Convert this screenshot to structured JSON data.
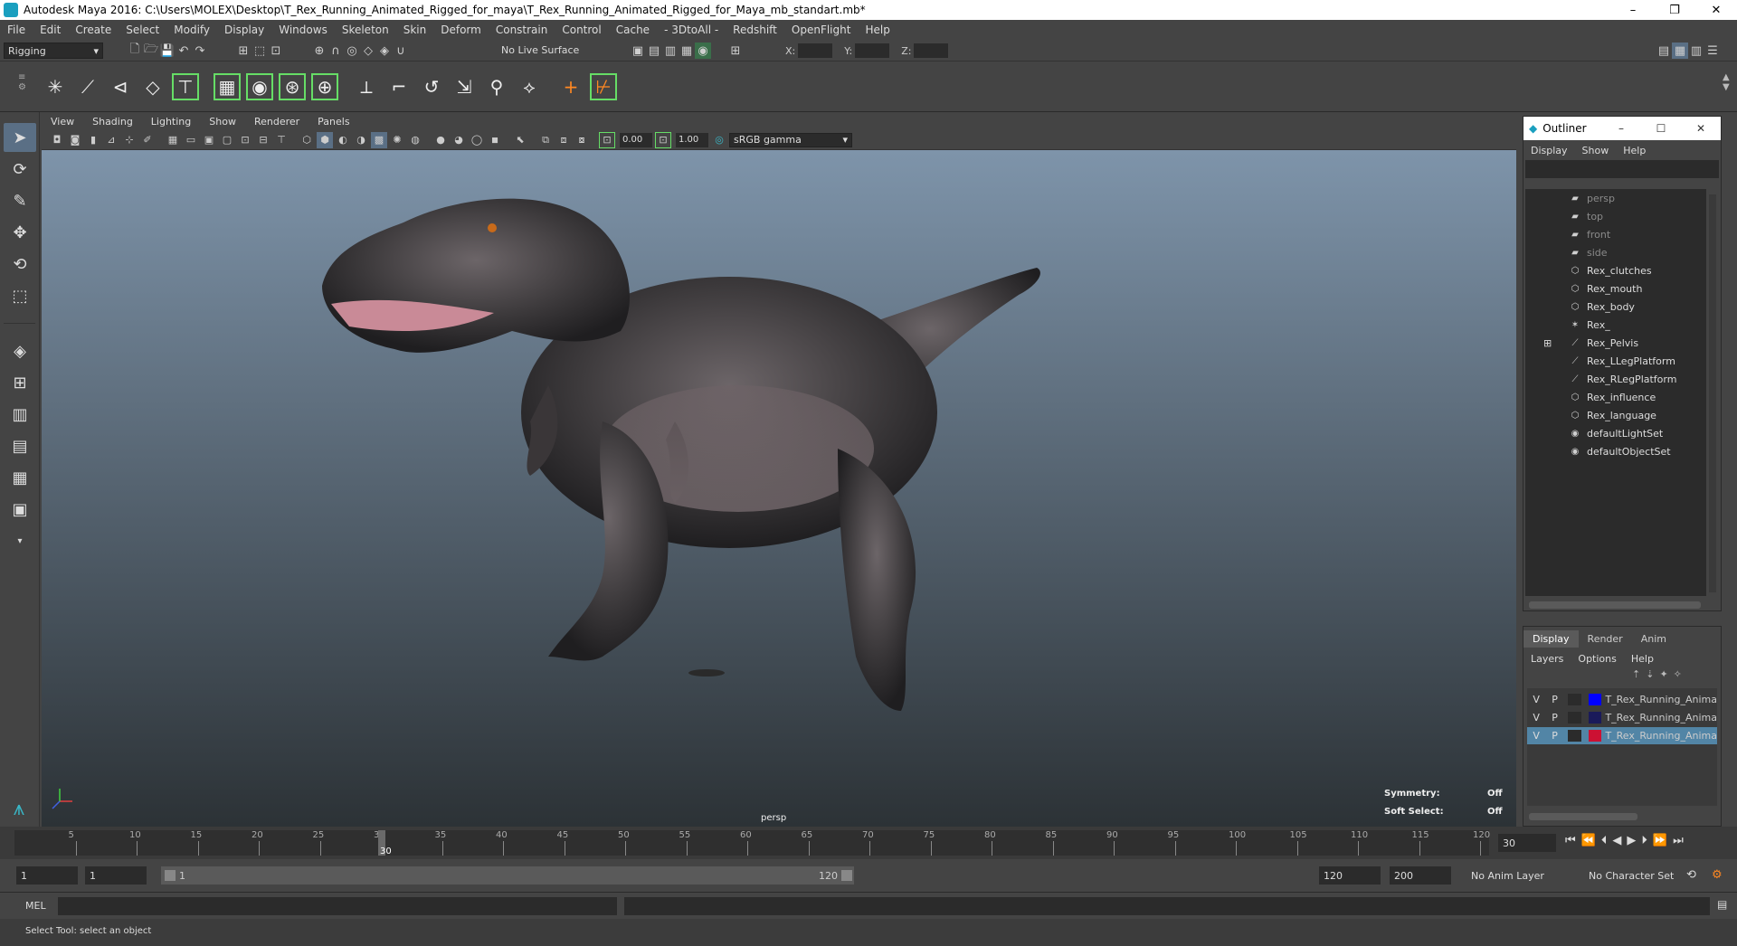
{
  "titlebar": {
    "title": "Autodesk Maya 2016: C:\\Users\\MOLEX\\Desktop\\T_Rex_Running_Animated_Rigged_for_maya\\T_Rex_Running_Animated_Rigged_for_Maya_mb_standart.mb*",
    "minimize": "–",
    "restore": "❐",
    "close": "✕"
  },
  "menubar": [
    "File",
    "Edit",
    "Create",
    "Select",
    "Modify",
    "Display",
    "Windows",
    "Skeleton",
    "Skin",
    "Deform",
    "Constrain",
    "Control",
    "Cache",
    "- 3DtoAll -",
    "Redshift",
    "OpenFlight",
    "Help"
  ],
  "statusline": {
    "menuset": "Rigging",
    "live_surface": "No Live Surface",
    "x_label": "X:",
    "y_label": "Y:",
    "z_label": "Z:"
  },
  "viewport": {
    "menu": [
      "View",
      "Shading",
      "Lighting",
      "Show",
      "Renderer",
      "Panels"
    ],
    "exposure": "0.00",
    "gamma": "1.00",
    "colorspace": "sRGB gamma",
    "camera_label": "persp",
    "hud": {
      "symmetry_label": "Symmetry:",
      "symmetry_value": "Off",
      "soft_select_label": "Soft Select:",
      "soft_select_value": "Off"
    }
  },
  "outliner": {
    "title": "Outliner",
    "menu": [
      "Display",
      "Show",
      "Help"
    ],
    "items": [
      {
        "label": "persp",
        "icon": "camera-icon",
        "dim": true
      },
      {
        "label": "top",
        "icon": "camera-icon",
        "dim": true
      },
      {
        "label": "front",
        "icon": "camera-icon",
        "dim": true
      },
      {
        "label": "side",
        "icon": "camera-icon",
        "dim": true
      },
      {
        "label": "Rex_clutches",
        "icon": "mesh-icon",
        "dim": false
      },
      {
        "label": "Rex_mouth",
        "icon": "mesh-icon",
        "dim": false
      },
      {
        "label": "Rex_body",
        "icon": "mesh-icon",
        "dim": false
      },
      {
        "label": "Rex_",
        "icon": "locator-icon",
        "dim": false
      },
      {
        "label": "Rex_Pelvis",
        "icon": "joint-icon",
        "dim": false
      },
      {
        "label": "Rex_LLegPlatform",
        "icon": "joint-icon",
        "dim": false
      },
      {
        "label": "Rex_RLegPlatform",
        "icon": "joint-icon",
        "dim": false
      },
      {
        "label": "Rex_influence",
        "icon": "mesh-icon",
        "dim": false
      },
      {
        "label": "Rex_language",
        "icon": "mesh-icon",
        "dim": false
      },
      {
        "label": "defaultLightSet",
        "icon": "set-icon",
        "dim": false
      },
      {
        "label": "defaultObjectSet",
        "icon": "set-icon",
        "dim": false
      }
    ]
  },
  "layers": {
    "tabs": [
      "Display",
      "Render",
      "Anim"
    ],
    "menu": [
      "Layers",
      "Options",
      "Help"
    ],
    "rows": [
      {
        "v": "V",
        "p": "P",
        "color": "#0000ff",
        "name": "T_Rex_Running_Anima"
      },
      {
        "v": "V",
        "p": "P",
        "color": "#1a1a5a",
        "name": "T_Rex_Running_Anima"
      },
      {
        "v": "V",
        "p": "P",
        "color": "#cc1133",
        "name": "T_Rex_Running_Anima"
      }
    ]
  },
  "timeslider": {
    "ticks": [
      "5",
      "10",
      "15",
      "20",
      "25",
      "30",
      "35",
      "40",
      "45",
      "50",
      "55",
      "60",
      "65",
      "70",
      "75",
      "80",
      "85",
      "90",
      "95",
      "100",
      "105",
      "110",
      "115",
      "120"
    ],
    "current_frame": "30",
    "playhead_label": "30"
  },
  "rangeslider": {
    "start": "1",
    "playback_start": "1",
    "range_start_label": "1",
    "range_end_label": "120",
    "playback_end": "120",
    "end": "200",
    "anim_layer": "No Anim Layer",
    "character_set": "No Character Set"
  },
  "cmdline": {
    "lang": "MEL"
  },
  "helpline": {
    "text": "Select Tool: select an object"
  }
}
